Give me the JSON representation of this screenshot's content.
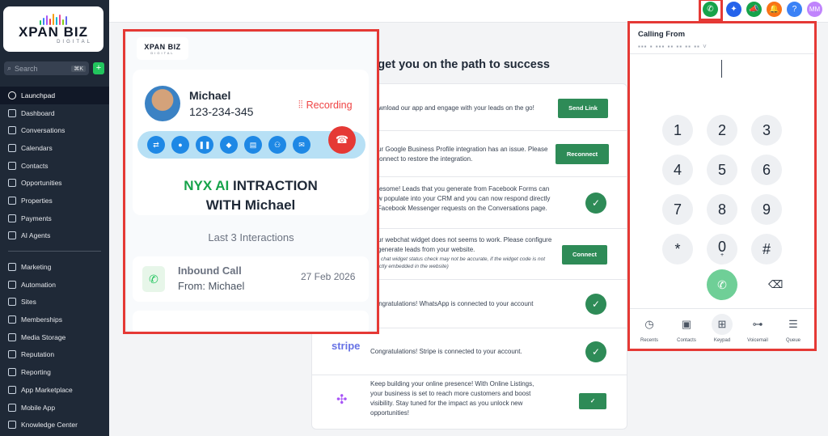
{
  "brand": {
    "name": "XPAN BIZ",
    "sub": "DIGITAL"
  },
  "sidebar": {
    "search_placeholder": "Search",
    "search_shortcut": "⌘K",
    "add_label": "+",
    "items_top": [
      "Launchpad",
      "Dashboard",
      "Conversations",
      "Calendars",
      "Contacts",
      "Opportunities",
      "Properties",
      "Payments",
      "AI Agents"
    ],
    "items_bottom": [
      "Marketing",
      "Automation",
      "Sites",
      "Memberships",
      "Media Storage",
      "Reputation",
      "Reporting",
      "App Marketplace",
      "Mobile App",
      "Knowledge Center"
    ]
  },
  "topbar": {
    "avatar_initials": "MM",
    "help": "?"
  },
  "center": {
    "title": "Let's get you on the path to success",
    "rows": [
      {
        "text": "Download our app and engage with your leads on the go!",
        "button": "Send Link"
      },
      {
        "text": "Your Google Business Profile integration has an issue. Please reconnect to restore the integration.",
        "button": "Reconnect"
      },
      {
        "text": "Awesome! Leads that you generate from Facebook Forms can now populate into your CRM and you can now respond directly to Facebook Messenger requests on the Conversations page."
      },
      {
        "text": "Your webchat widget does not seems to work. Please configure to generate leads from your website.",
        "note": "The chat widget status check may not be accurate, if the widget code is not directly embedded in the website)",
        "button": "Connect"
      },
      {
        "text": "Congratulations! WhatsApp is connected to your account"
      },
      {
        "logo": "stripe",
        "text": "Congratulations! Stripe is connected to your account."
      },
      {
        "text": "Keep building your online presence! With Online Listings, your business is set to reach more customers and boost visibility. Stay tuned for the impact as you unlock new opportunities!"
      }
    ]
  },
  "overlay": {
    "contact_name": "Michael",
    "contact_phone": "123-234-345",
    "recording": "Recording",
    "ai_line1_green": "NYX AI",
    "ai_line1_rest": " INTRACTION",
    "ai_line2": "WITH Michael",
    "last_interactions": "Last 3 Interactions",
    "interaction": {
      "title": "Inbound Call",
      "from": "From: Michael",
      "date": "27 Feb 2026"
    }
  },
  "dialer": {
    "title": "Calling From",
    "keys": [
      "1",
      "2",
      "3",
      "4",
      "5",
      "6",
      "7",
      "8",
      "9",
      "*",
      "0",
      "#"
    ],
    "zero_sub": "+",
    "tabs": [
      "Recents",
      "Contacts",
      "Keypad",
      "Voicemail",
      "Queue"
    ]
  },
  "colors": {
    "accent_green": "#2e8b57",
    "highlight_red": "#e53935",
    "sidebar_bg": "#1f2937"
  }
}
